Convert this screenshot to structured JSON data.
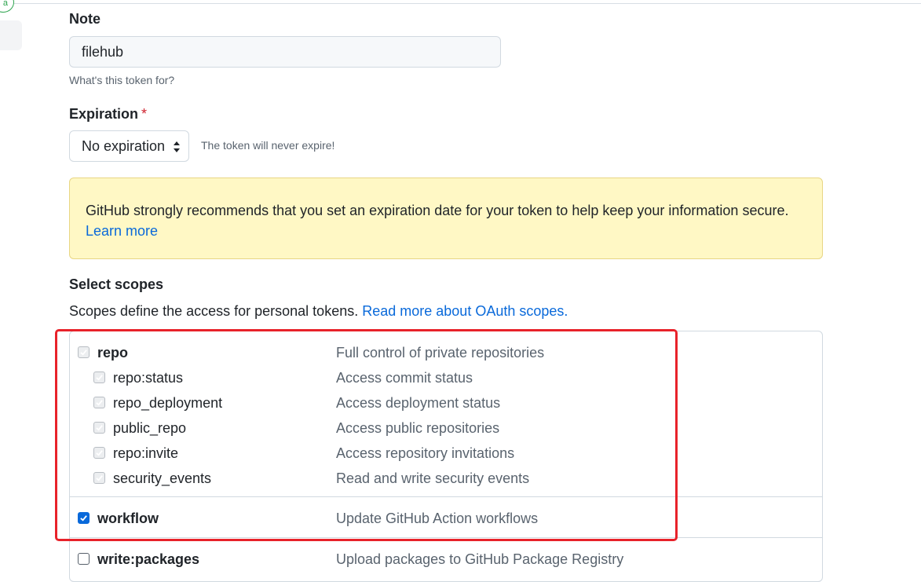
{
  "note": {
    "label": "Note",
    "value": "filehub",
    "hint": "What's this token for?"
  },
  "expiration": {
    "label": "Expiration",
    "required_mark": "*",
    "selected": "No expiration",
    "hint": "The token will never expire!"
  },
  "flash": {
    "message": "GitHub strongly recommends that you set an expiration date for your token to help keep your information secure.",
    "link": "Learn more"
  },
  "scopes": {
    "heading": "Select scopes",
    "description": "Scopes define the access for personal tokens.",
    "description_link": "Read more about OAuth scopes.",
    "groups": [
      {
        "name": "repo",
        "desc": "Full control of private repositories",
        "state": "checked-disabled",
        "children": [
          {
            "name": "repo:status",
            "desc": "Access commit status"
          },
          {
            "name": "repo_deployment",
            "desc": "Access deployment status"
          },
          {
            "name": "public_repo",
            "desc": "Access public repositories"
          },
          {
            "name": "repo:invite",
            "desc": "Access repository invitations"
          },
          {
            "name": "security_events",
            "desc": "Read and write security events"
          }
        ]
      },
      {
        "name": "workflow",
        "desc": "Update GitHub Action workflows",
        "state": "checked"
      },
      {
        "name": "write:packages",
        "desc": "Upload packages to GitHub Package Registry",
        "state": "unchecked"
      }
    ]
  },
  "colors": {
    "accent": "#0969da",
    "flash_bg": "#fff8c5",
    "highlight_frame": "#e8222a"
  }
}
